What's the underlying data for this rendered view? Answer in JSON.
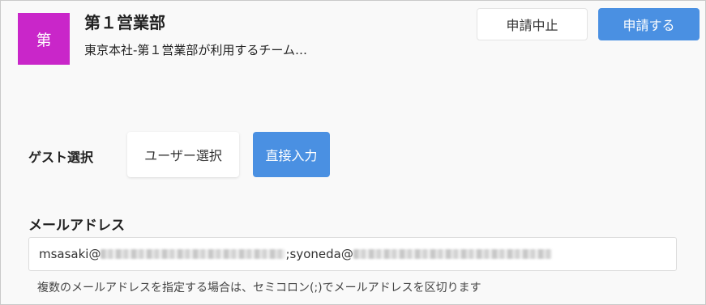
{
  "team": {
    "icon_char": "第",
    "icon_color": "#c926c9",
    "name": "第１営業部",
    "description": "東京本社-第１営業部が利用するチーム…"
  },
  "actions": {
    "cancel_apply_label": "申請中止",
    "apply_label": "申請する",
    "accent_color": "#4a90e2"
  },
  "guest": {
    "label": "ゲスト選択",
    "options": [
      {
        "label": "ユーザー選択",
        "selected": false
      },
      {
        "label": "直接入力",
        "selected": true
      }
    ]
  },
  "email": {
    "label": "メールアドレス",
    "value_part1": "msasaki@",
    "value_part2": ";syoneda@",
    "help_text": "複数のメールアドレスを指定する場合は、セミコロン(;)でメールアドレスを区切ります"
  }
}
